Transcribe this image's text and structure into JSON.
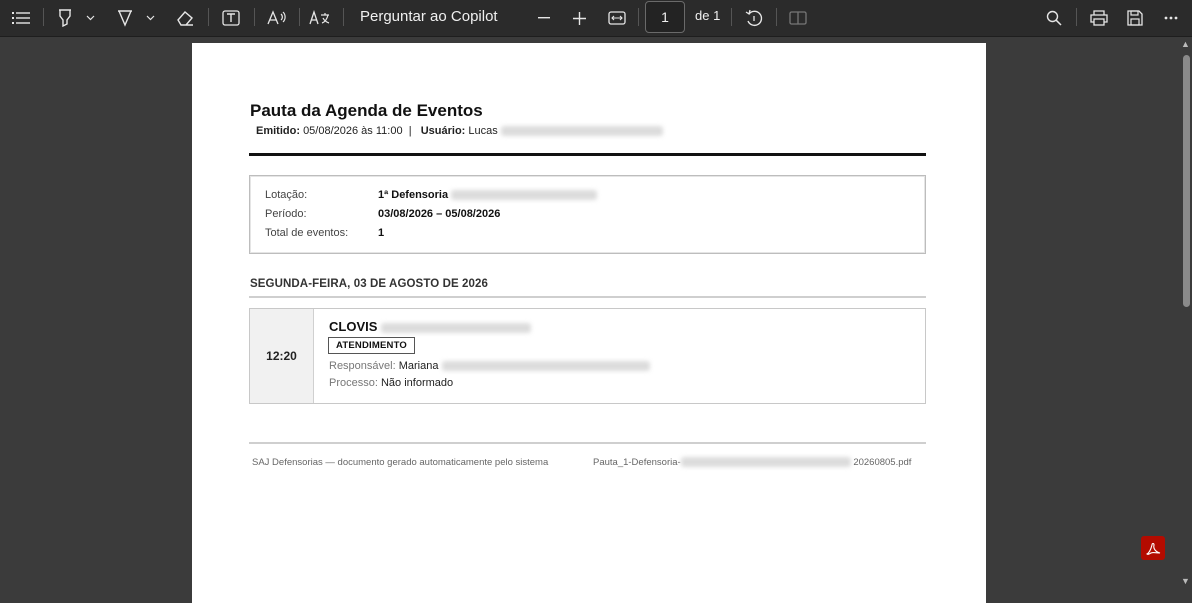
{
  "toolbar": {
    "copilot_label": "Perguntar ao Copilot",
    "page_current": "1",
    "page_of": "de 1",
    "icons": [
      "contents-icon",
      "highlight-icon",
      "draw-icon",
      "erase-icon",
      "text-box-icon",
      "read-aloud-icon",
      "translate-icon",
      "zoom-out-icon",
      "zoom-in-icon",
      "fit-page-icon",
      "rotate-icon",
      "two-page-icon",
      "search-icon",
      "print-icon",
      "save-icon",
      "more-icon"
    ]
  },
  "document": {
    "title": "Pauta da Agenda de Eventos",
    "issued_label": "Emitido:",
    "issued_value": "05/08/2026 às 11:00",
    "separator": "|",
    "user_label": "Usuário:",
    "user_value": "Lucas",
    "info": {
      "lotacao_label": "Lotação:",
      "lotacao_value": "1ª Defensoria",
      "periodo_label": "Período:",
      "periodo_value": "03/08/2026 – 05/08/2026",
      "total_label": "Total de eventos:",
      "total_value": "1"
    },
    "day_header": "SEGUNDA-FEIRA, 03 DE AGOSTO DE 2026",
    "event": {
      "time": "12:20",
      "name": "CLOVIS",
      "badge": "ATENDIMENTO",
      "responsavel_label": "Responsável:",
      "responsavel_value": "Mariana",
      "processo_label": "Processo:",
      "processo_value": "Não informado"
    },
    "footer_left": "SAJ Defensorias — documento gerado automaticamente pelo sistema",
    "footer_right_prefix": "Pauta_1-Defensoria-",
    "footer_right_suffix": "20260805.pdf"
  },
  "colors": {
    "accent_pdf": "#b30b00",
    "toolbar_bg": "#2b2b2b",
    "canvas_bg": "#3b3b3b"
  }
}
